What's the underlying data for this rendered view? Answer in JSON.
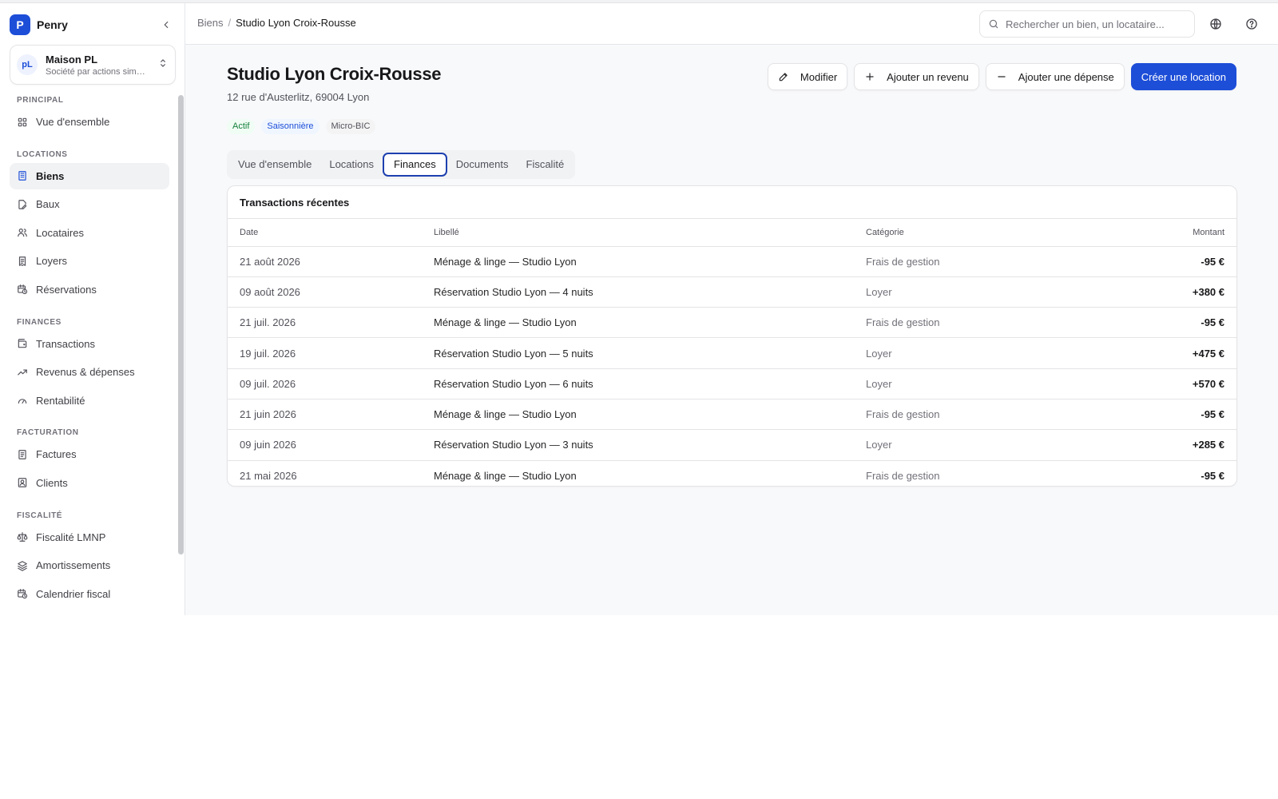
{
  "brand": {
    "logo_letter": "P",
    "name": "Penry"
  },
  "org": {
    "avatar": "pL",
    "name": "Maison PL",
    "subtitle": "Société par actions sim…"
  },
  "sidebar": {
    "sections": [
      {
        "title": "PRINCIPAL",
        "items": [
          {
            "label": "Vue d'ensemble",
            "icon": "grid-icon"
          }
        ]
      },
      {
        "title": "LOCATIONS",
        "items": [
          {
            "label": "Biens",
            "icon": "building-icon",
            "active": true
          },
          {
            "label": "Baux",
            "icon": "file-edit-icon"
          },
          {
            "label": "Locataires",
            "icon": "users-icon"
          },
          {
            "label": "Loyers",
            "icon": "receipt-icon"
          },
          {
            "label": "Réservations",
            "icon": "calendar-clock-icon"
          }
        ]
      },
      {
        "title": "FINANCES",
        "items": [
          {
            "label": "Transactions",
            "icon": "wallet-icon"
          },
          {
            "label": "Revenus & dépenses",
            "icon": "trending-up-icon"
          },
          {
            "label": "Rentabilité",
            "icon": "gauge-icon"
          }
        ]
      },
      {
        "title": "FACTURATION",
        "items": [
          {
            "label": "Factures",
            "icon": "invoice-icon"
          },
          {
            "label": "Clients",
            "icon": "contact-icon"
          }
        ]
      },
      {
        "title": "FISCALITÉ",
        "items": [
          {
            "label": "Fiscalité LMNP",
            "icon": "scale-icon"
          },
          {
            "label": "Amortissements",
            "icon": "layers-icon"
          },
          {
            "label": "Calendrier fiscal",
            "icon": "calendar-clock-icon"
          }
        ]
      }
    ]
  },
  "header": {
    "breadcrumb_parent": "Biens",
    "breadcrumb_sep": "/",
    "breadcrumb_current": "Studio Lyon Croix-Rousse",
    "search_placeholder": "Rechercher un bien, un locataire..."
  },
  "property": {
    "title": "Studio Lyon Croix-Rousse",
    "address": "12 rue d'Austerlitz, 69004 Lyon",
    "badges": {
      "status": "Actif",
      "type": "Saisonnière",
      "regime": "Micro-BIC"
    }
  },
  "actions": {
    "edit": "Modifier",
    "add_income": "Ajouter un revenu",
    "add_expense": "Ajouter une dépense",
    "create_rental": "Créer une location"
  },
  "tabs": [
    "Vue d'ensemble",
    "Locations",
    "Finances",
    "Documents",
    "Fiscalité"
  ],
  "active_tab": 2,
  "transactions": {
    "title": "Transactions récentes",
    "columns": {
      "date": "Date",
      "label": "Libellé",
      "category": "Catégorie",
      "amount": "Montant"
    },
    "rows": [
      {
        "date": "21 août 2026",
        "label": "Ménage & linge — Studio Lyon",
        "category": "Frais de gestion",
        "amount": "-95 €"
      },
      {
        "date": "09 août 2026",
        "label": "Réservation Studio Lyon — 4 nuits",
        "category": "Loyer",
        "amount": "+380 €"
      },
      {
        "date": "21 juil. 2026",
        "label": "Ménage & linge — Studio Lyon",
        "category": "Frais de gestion",
        "amount": "-95 €"
      },
      {
        "date": "19 juil. 2026",
        "label": "Réservation Studio Lyon — 5 nuits",
        "category": "Loyer",
        "amount": "+475 €"
      },
      {
        "date": "09 juil. 2026",
        "label": "Réservation Studio Lyon — 6 nuits",
        "category": "Loyer",
        "amount": "+570 €"
      },
      {
        "date": "21 juin 2026",
        "label": "Ménage & linge — Studio Lyon",
        "category": "Frais de gestion",
        "amount": "-95 €"
      },
      {
        "date": "09 juin 2026",
        "label": "Réservation Studio Lyon — 3 nuits",
        "category": "Loyer",
        "amount": "+285 €"
      },
      {
        "date": "21 mai 2026",
        "label": "Ménage & linge — Studio Lyon",
        "category": "Frais de gestion",
        "amount": "-95 €"
      }
    ]
  },
  "colors": {
    "primary": "#1d4ed8",
    "badge_green": "#15803d",
    "badge_blue": "#1d4ed8"
  }
}
